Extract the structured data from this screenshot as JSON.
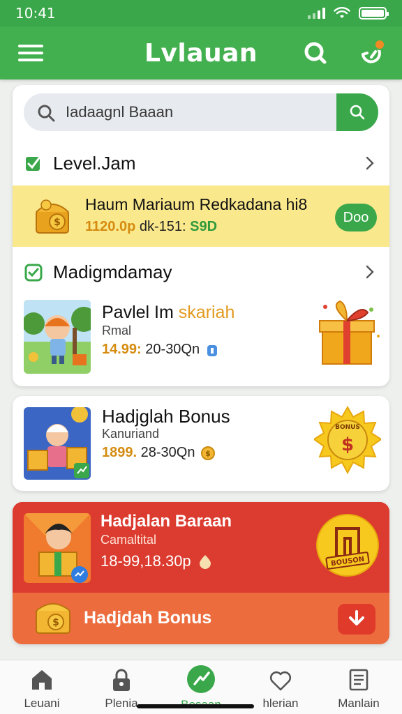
{
  "status": {
    "time": "10:41"
  },
  "app": {
    "title": "Lvlauan"
  },
  "search": {
    "placeholder": "Iadaagnl Baaan"
  },
  "section1": {
    "title": "Level.Jam"
  },
  "promo_strip": {
    "title": "Haum Mariaum Redkadana hi8",
    "price": "1120.0p",
    "range": " dk-151:",
    "amount": " S9D",
    "button": "Doo"
  },
  "section2": {
    "title": "Madigmdamay"
  },
  "item1": {
    "title": "Pavlel Im ",
    "title_highlight": "skariah",
    "subtitle": "Rmal",
    "price": "14.99:",
    "range": "20-30Qn"
  },
  "bonus_card": {
    "title": "Hadjglah Bonus",
    "subtitle": "Kanuriand",
    "price": "1899.",
    "range": "28-30Qn",
    "badge_text": "BONUS"
  },
  "red_card": {
    "title": "Hadjalan Baraan",
    "subtitle": "Camaltital",
    "meta": "18-99,18.30p",
    "badge_text": "BOUSON"
  },
  "orange_bar": {
    "label": "Hadjdah Bonus"
  },
  "bottom_nav": [
    {
      "label": "Leuani",
      "icon": "home-icon"
    },
    {
      "label": "Plenia",
      "icon": "lock-icon"
    },
    {
      "label": "Bosaan",
      "icon": "flash-icon"
    },
    {
      "label": "hlerian",
      "icon": "heart-icon"
    },
    {
      "label": "Manlain",
      "icon": "list-icon"
    }
  ],
  "colors": {
    "green": "#3aa84a",
    "yellow_strip": "#fae88c",
    "red": "#dc3b2f",
    "orange": "#ec6c3e"
  }
}
